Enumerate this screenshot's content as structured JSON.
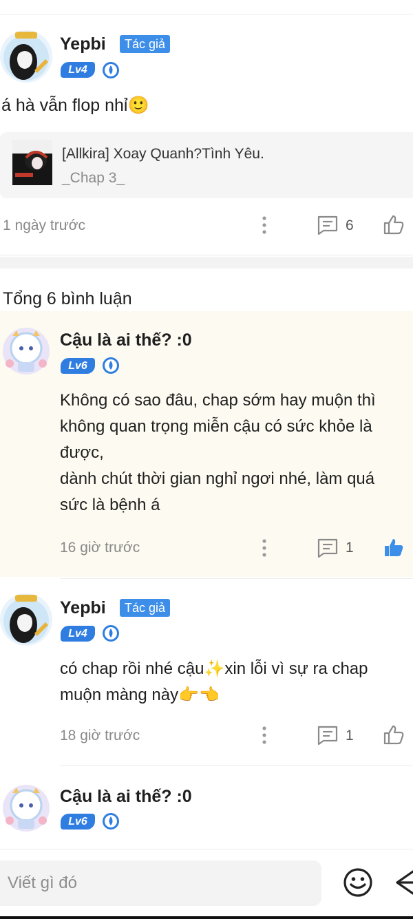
{
  "colors": {
    "accent": "#3d8ee8",
    "like_active": "#3d8ee8",
    "highlight_bg": "#fdfaf1"
  },
  "post": {
    "author": "Yepbi",
    "author_badge": "Tác giả",
    "level": "Lv4",
    "content": "á hà vẫn flop nhỉ🙂",
    "chapter": {
      "title": "[Allkira] Xoay Quanh?Tình Yêu.",
      "subtitle": "_Chap 3_"
    },
    "time": "1 ngày trước",
    "reply_count": "6",
    "icons": {
      "more": "more-vertical-icon",
      "comment": "comment-icon",
      "like": "thumbs-up-icon"
    }
  },
  "comments_header": "Tổng 6 bình luận",
  "comments": [
    {
      "name": "Cậu là ai thế? :0",
      "level": "Lv6",
      "lines": [
        "Không có sao đâu, chap sớm hay muộn thì",
        "không quan trọng miễn cậu có sức khỏe là",
        "được,",
        "dành chút thời gian nghỉ ngơi nhé, làm quá",
        "sức là bệnh á"
      ],
      "time": "16 giờ trước",
      "reply_count": "1",
      "liked": true
    },
    {
      "name": "Yepbi",
      "author_badge": "Tác giả",
      "level": "Lv4",
      "lines": [
        "có chap rồi nhé cậu✨xin lỗi vì sự ra chap",
        "muộn màng này👉👈"
      ],
      "time": "18 giờ trước",
      "reply_count": "1",
      "liked": false
    },
    {
      "name": "Cậu là ai thế? :0",
      "level": "Lv6"
    }
  ],
  "composer": {
    "placeholder": "Viết gì đó",
    "emoji_icon": "emoji-icon",
    "send_icon": "send-icon"
  }
}
